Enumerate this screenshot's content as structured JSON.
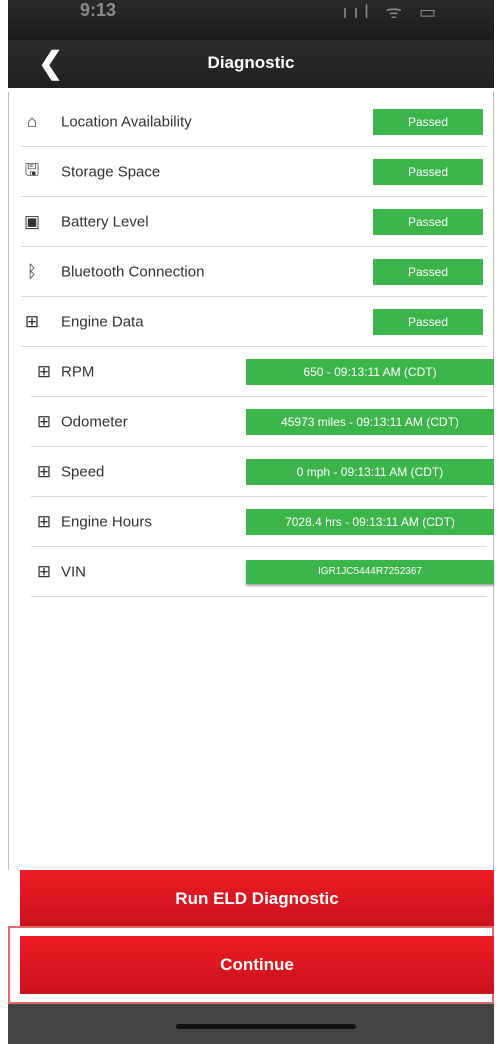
{
  "status_bar": {
    "time": "9:13",
    "icons": "ııl ᯤ ▭"
  },
  "header": {
    "title": "Diagnostic",
    "back_glyph": "❮"
  },
  "checks": [
    {
      "icon": "home-icon",
      "glyph": "⌂",
      "label": "Location Availability",
      "status": "Passed"
    },
    {
      "icon": "storage-icon",
      "glyph": "🖫",
      "label": "Storage Space",
      "status": "Passed"
    },
    {
      "icon": "battery-icon",
      "glyph": "▣",
      "label": "Battery Level",
      "status": "Passed"
    },
    {
      "icon": "bluetooth-icon",
      "glyph": "ᛒ",
      "label": "Bluetooth Connection",
      "status": "Passed"
    },
    {
      "icon": "engine-data-icon",
      "glyph": "⊞",
      "label": "Engine Data",
      "status": "Passed"
    }
  ],
  "engine_details": [
    {
      "label": "RPM",
      "value": "650 - 09:13:11 AM (CDT)"
    },
    {
      "label": "Odometer",
      "value": "45973 miles - 09:13:11 AM (CDT)"
    },
    {
      "label": "Speed",
      "value": "0 mph - 09:13:11 AM (CDT)"
    },
    {
      "label": "Engine Hours",
      "value": "7028.4 hrs - 09:13:11 AM (CDT)"
    },
    {
      "label": "VIN",
      "value": "IGR1JC5444R7252367"
    }
  ],
  "sub_icon_glyph": "⊞",
  "buttons": {
    "run_diagnostic": "Run ELD Diagnostic",
    "continue": "Continue"
  },
  "colors": {
    "passed": "#3cb64a",
    "primary_button": "#e31b23"
  }
}
